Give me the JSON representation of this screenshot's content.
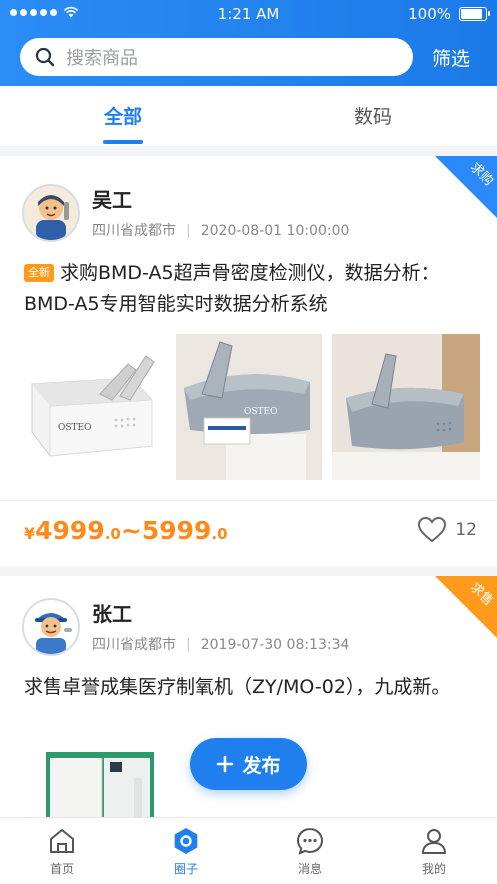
{
  "status_bar": {
    "time": "1:21 AM",
    "battery": "100%"
  },
  "search": {
    "placeholder": "搜索商品",
    "filter_label": "筛选"
  },
  "tabs": [
    {
      "label": "全部",
      "active": true
    },
    {
      "label": "数码",
      "active": false
    }
  ],
  "posts": [
    {
      "user": "吴工",
      "location": "四川省成都市",
      "datetime": "2020-08-01 10:00:00",
      "corner_label": "求购",
      "corner_color": "#2b8af7",
      "badge": "全新",
      "title": "求购BMD-A5超声骨密度检测仪，数据分析：BMD-A5专用智能实时数据分析系统",
      "price": {
        "currency": "¥",
        "low_int": "4999",
        "low_dec": ".0",
        "tilde": "~",
        "high_int": "5999",
        "high_dec": ".0"
      },
      "likes": "12",
      "image_label": "OSTEO",
      "image_label_2": "OSTEO"
    },
    {
      "user": "张工",
      "location": "四川省成都市",
      "datetime": "2019-07-30 08:13:34",
      "corner_label": "求售",
      "corner_color": "#ff9a1a",
      "title": "求售卓誉成集医疗制氧机（ZY/MO-02），九成新。"
    }
  ],
  "fab": {
    "label": "发布"
  },
  "tabbar": [
    {
      "label": "首页",
      "icon": "home-icon",
      "active": false
    },
    {
      "label": "圈子",
      "icon": "circle-icon",
      "active": true
    },
    {
      "label": "消息",
      "icon": "message-icon",
      "active": false
    },
    {
      "label": "我的",
      "icon": "profile-icon",
      "active": false
    }
  ]
}
